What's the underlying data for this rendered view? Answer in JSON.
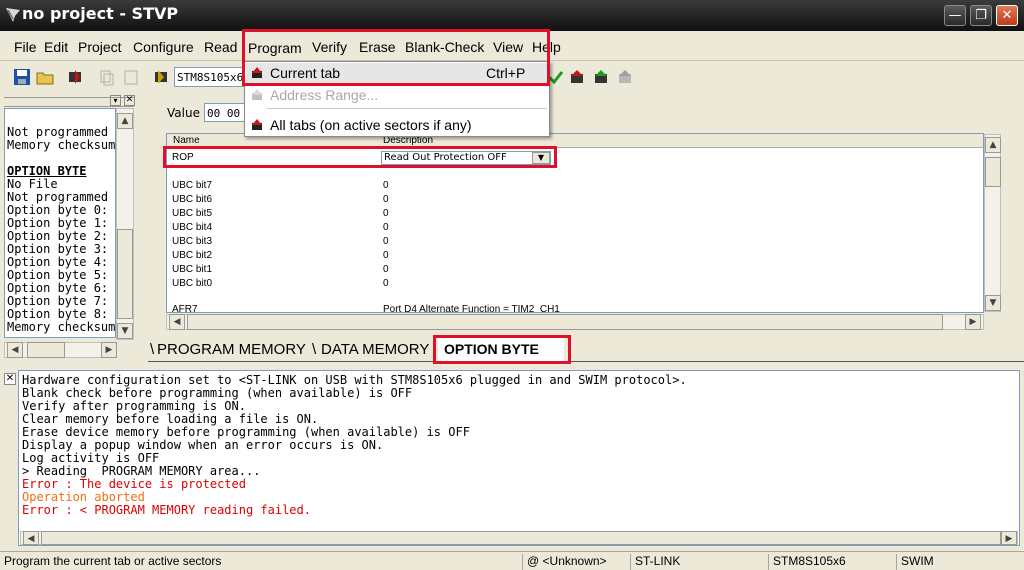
{
  "window": {
    "title": "no project - STVP"
  },
  "menu": {
    "items": [
      {
        "label": "File",
        "accel": "F"
      },
      {
        "label": "Edit",
        "accel": "E"
      },
      {
        "label": "Project",
        "accel": "r"
      },
      {
        "label": "Configure",
        "accel": "C"
      },
      {
        "label": "Read",
        "accel": "R"
      },
      {
        "label": "Program",
        "accel": "P"
      },
      {
        "label": "Verify",
        "accel": "V"
      },
      {
        "label": "Erase",
        "accel": "a"
      },
      {
        "label": "Blank-Check",
        "accel": "B"
      },
      {
        "label": "View",
        "accel": "V"
      },
      {
        "label": "Help",
        "accel": "l"
      }
    ]
  },
  "program_menu": {
    "current_tab": "Current tab",
    "current_tab_shortcut": "Ctrl+P",
    "address_range": "Address Range...",
    "all_tabs": "All tabs (on active sectors if any)"
  },
  "toolbar": {
    "device": "STM8S105x6"
  },
  "left_panel": {
    "lines": [
      "Not programmed",
      "Memory checksum",
      "",
      "OPTION BYTE",
      "No File",
      "Not programmed",
      "Option byte 0:",
      "Option byte 1:",
      "Option byte 2:",
      "Option byte 3:",
      "Option byte 4:",
      "Option byte 5:",
      "Option byte 6:",
      "Option byte 7:",
      "Option byte 8:",
      "Memory checksum"
    ]
  },
  "option_grid": {
    "value_label": "Value :",
    "value": "00 00 00",
    "col_name": "Name",
    "col_description": "Description",
    "rop_name": "ROP",
    "rop_value": "Read Out Protection OFF",
    "rows": [
      {
        "name": "UBC bit7",
        "value": "0"
      },
      {
        "name": "UBC bit6",
        "value": "0"
      },
      {
        "name": "UBC bit5",
        "value": "0"
      },
      {
        "name": "UBC bit4",
        "value": "0"
      },
      {
        "name": "UBC bit3",
        "value": "0"
      },
      {
        "name": "UBC bit2",
        "value": "0"
      },
      {
        "name": "UBC bit1",
        "value": "0"
      },
      {
        "name": "UBC bit0",
        "value": "0"
      }
    ],
    "partial_name": "AFR7",
    "partial_value": "Port D4 Alternate Function = TIM2_CH1"
  },
  "tabs": {
    "program_memory": "PROGRAM MEMORY",
    "data_memory": "DATA MEMORY",
    "option_byte": "OPTION BYTE"
  },
  "log": {
    "lines": [
      {
        "text": "Hardware configuration set to <ST-LINK on USB with STM8S105x6 plugged in and SWIM protocol>.",
        "color": "#000000"
      },
      {
        "text": "Blank check before programming (when available) is OFF",
        "color": "#000000"
      },
      {
        "text": "Verify after programming is ON.",
        "color": "#000000"
      },
      {
        "text": "Clear memory before loading a file is ON.",
        "color": "#000000"
      },
      {
        "text": "Erase device memory before programming (when available) is OFF",
        "color": "#000000"
      },
      {
        "text": "Display a popup window when an error occurs is ON.",
        "color": "#000000"
      },
      {
        "text": "Log activity is OFF",
        "color": "#000000"
      },
      {
        "text": "> Reading  PROGRAM MEMORY area...",
        "color": "#000000"
      },
      {
        "text": "Error : The device is protected",
        "color": "#e00000"
      },
      {
        "text": "Operation aborted",
        "color": "#f07010"
      },
      {
        "text": "Error : < PROGRAM MEMORY reading failed.",
        "color": "#e00000"
      }
    ]
  },
  "status": {
    "message": "Program the current tab or active sectors",
    "location": "@ <Unknown>",
    "tool": "ST-LINK",
    "device": "STM8S105x6",
    "protocol": "SWIM"
  },
  "colors": {
    "highlight": "#e0102a",
    "title_bar": "#1a1a1a"
  }
}
